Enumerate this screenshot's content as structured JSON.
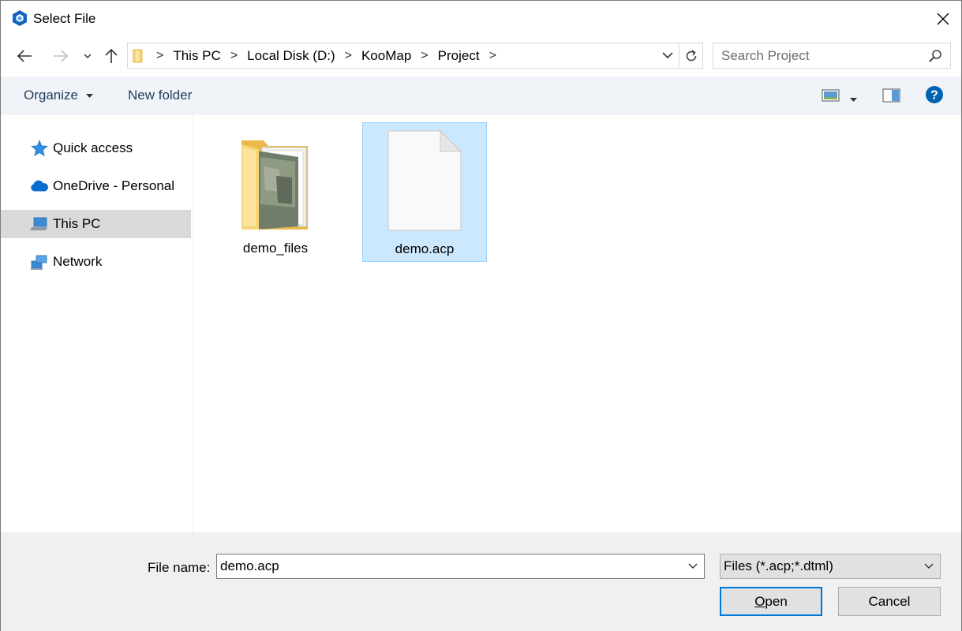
{
  "window": {
    "title": "Select File",
    "accent_color": "#0078d7"
  },
  "navigation": {
    "back_icon": "arrow-left-icon",
    "forward_icon": "arrow-right-icon",
    "recent_icon": "chevron-down-icon",
    "up_icon": "arrow-up-icon",
    "breadcrumb": [
      "This PC",
      "Local Disk (D:)",
      "KooMap",
      "Project"
    ],
    "search_placeholder": "Search Project"
  },
  "toolbar": {
    "organize_label": "Organize",
    "new_folder_label": "New folder"
  },
  "sidebar": {
    "items": [
      {
        "label": "Quick access",
        "icon": "star-icon"
      },
      {
        "label": "OneDrive - Personal",
        "icon": "cloud-icon"
      },
      {
        "label": "This PC",
        "icon": "computer-icon",
        "selected": true
      },
      {
        "label": "Network",
        "icon": "network-icon"
      }
    ]
  },
  "files": [
    {
      "name": "demo_files",
      "type": "folder",
      "icon": "folder-icon"
    },
    {
      "name": "demo.acp",
      "type": "file",
      "icon": "document-icon",
      "selected": true
    }
  ],
  "bottom": {
    "file_name_label": "File name:",
    "file_name_value": "demo.acp",
    "file_type_value": "Files (*.acp;*.dtml)",
    "open_label": "Open",
    "cancel_label": "Cancel"
  }
}
